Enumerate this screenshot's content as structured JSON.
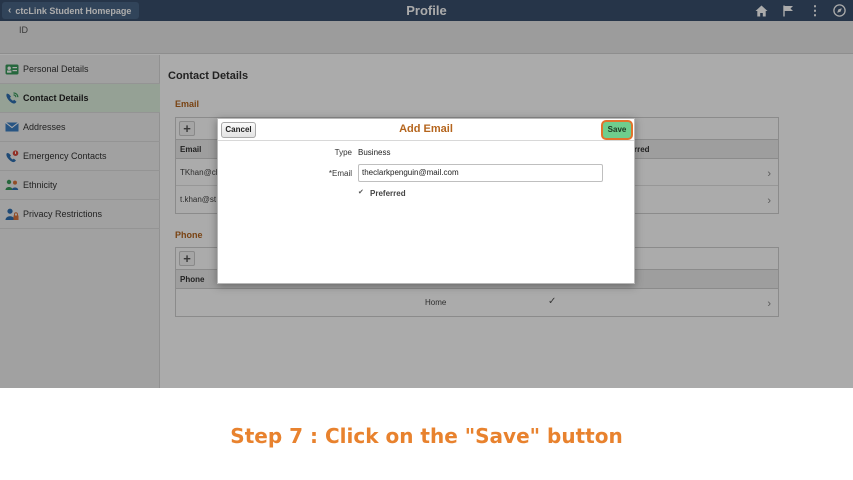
{
  "header": {
    "back_label": "ctcLink Student Homepage",
    "title": "Profile",
    "icons": [
      "home-icon",
      "flag-icon",
      "more-menu-icon",
      "compass-icon"
    ]
  },
  "subheader": {
    "id_label": "ID"
  },
  "sidebar": {
    "items": [
      {
        "label": "Personal Details",
        "icon": "id-card-icon"
      },
      {
        "label": "Contact Details",
        "icon": "phone-icon",
        "active": true
      },
      {
        "label": "Addresses",
        "icon": "envelope-icon"
      },
      {
        "label": "Emergency Contacts",
        "icon": "emergency-phone-icon"
      },
      {
        "label": "Ethnicity",
        "icon": "people-icon"
      },
      {
        "label": "Privacy Restrictions",
        "icon": "person-lock-icon"
      }
    ]
  },
  "main": {
    "section_title": "Contact Details",
    "email": {
      "title": "Email",
      "col_email": "Email",
      "col_preferred_partial": "rred",
      "rows": [
        {
          "email_partial": "TKhan@cl"
        },
        {
          "email_partial": "t.khan@st"
        }
      ]
    },
    "phone": {
      "title": "Phone",
      "col_phone": "Phone",
      "rows": [
        {
          "type": "Home",
          "preferred_mark": "✓"
        }
      ]
    }
  },
  "modal": {
    "title": "Add Email",
    "cancel_label": "Cancel",
    "save_label": "Save",
    "type_label": "Type",
    "type_value": "Business",
    "email_label": "*Email",
    "email_value": "theclarkpenguin@mail.com",
    "preferred_label": "Preferred",
    "preferred_checked": true
  },
  "footer": {
    "step_text": "Step 7 : Click on the \"Save\" button"
  },
  "colors": {
    "header": "#39506d",
    "accent": "#b5651d",
    "save": "#6fce8d",
    "highlight": "#e2732c",
    "step": "#e8822e"
  }
}
